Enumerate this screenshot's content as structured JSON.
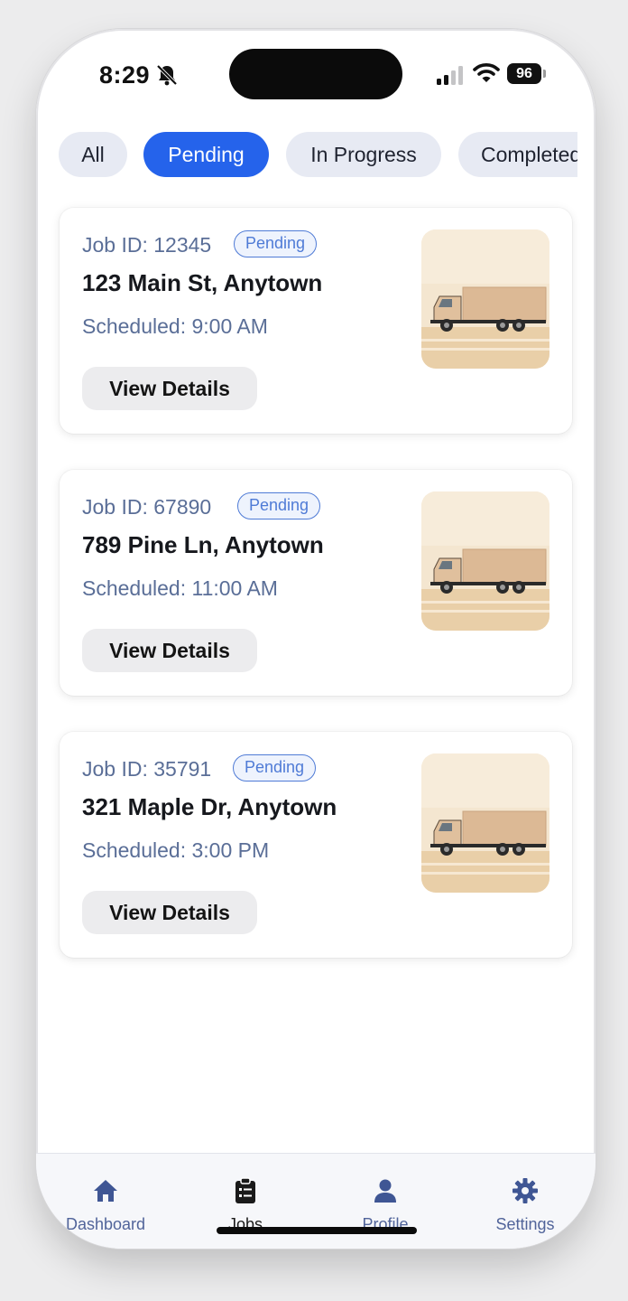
{
  "status_bar": {
    "time": "8:29",
    "battery": "96",
    "icons": [
      "bell-off-icon",
      "signal-icon",
      "wifi-icon",
      "battery-icon"
    ]
  },
  "filters": [
    {
      "label": "All",
      "active": false
    },
    {
      "label": "Pending",
      "active": true
    },
    {
      "label": "In Progress",
      "active": false
    },
    {
      "label": "Completed",
      "active": false
    }
  ],
  "jobs": [
    {
      "job_id": "Job ID: 12345",
      "status": "Pending",
      "address": "123 Main St, Anytown",
      "scheduled": "Scheduled: 9:00 AM",
      "action": "View Details",
      "image": "delivery-truck-illustration"
    },
    {
      "job_id": "Job ID: 67890",
      "status": "Pending",
      "address": "789 Pine Ln, Anytown",
      "scheduled": "Scheduled: 11:00 AM",
      "action": "View Details",
      "image": "delivery-truck-illustration"
    },
    {
      "job_id": "Job ID: 35791",
      "status": "Pending",
      "address": "321 Maple Dr, Anytown",
      "scheduled": "Scheduled: 3:00 PM",
      "action": "View Details",
      "image": "delivery-truck-illustration"
    }
  ],
  "tab_bar": [
    {
      "label": "Dashboard",
      "icon": "home-icon",
      "active": false
    },
    {
      "label": "Jobs",
      "icon": "clipboard-list-icon",
      "active": true
    },
    {
      "label": "Profile",
      "icon": "person-icon",
      "active": false
    },
    {
      "label": "Settings",
      "icon": "gear-icon",
      "active": false
    }
  ],
  "colors": {
    "accent": "#2563eb",
    "chip_bg": "#e7eaf3",
    "muted_text": "#5a6e97",
    "badge_border": "#4f7bd6",
    "tab_inactive": "#51649a",
    "thumb_bg": "#f4e6d0",
    "truck_body": "#dcb995"
  }
}
